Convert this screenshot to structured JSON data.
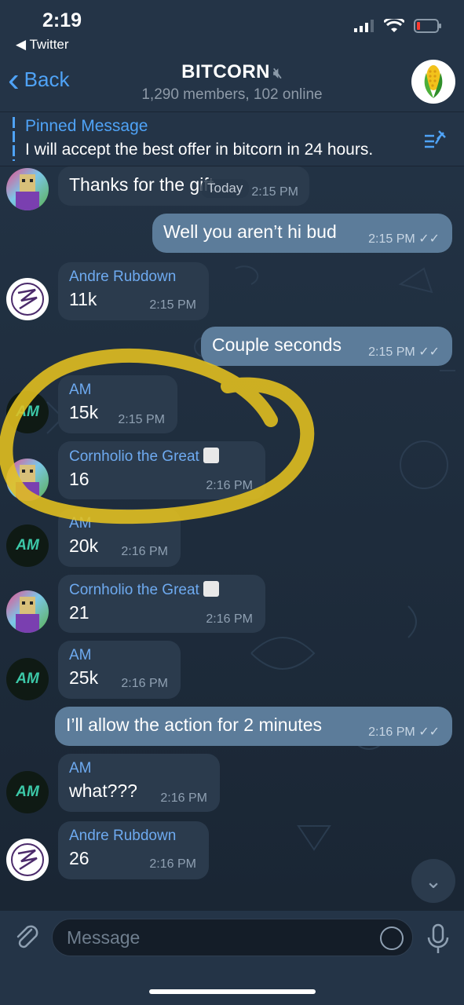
{
  "status": {
    "time": "2:19",
    "back_app": "◀ Twitter"
  },
  "header": {
    "back_label": "Back",
    "title": "BITCORN",
    "subtitle": "1,290 members, 102 online",
    "mute_icon": "speaker-muted-icon"
  },
  "pinned": {
    "title": "Pinned Message",
    "text": "I will accept the best offer in bitcorn in 24 hours."
  },
  "messages": [
    {
      "kind": "in",
      "sender": "",
      "text": "Thanks for the gift",
      "time": "2:15 PM",
      "overlay": "Today"
    },
    {
      "kind": "out",
      "text": "Well you aren’t hi bud",
      "time": "2:15 PM"
    },
    {
      "kind": "in",
      "sender": "Andre Rubdown",
      "text": "11k",
      "time": "2:15 PM"
    },
    {
      "kind": "out",
      "text": "Couple seconds",
      "time": "2:15 PM"
    },
    {
      "kind": "in",
      "sender": "AM",
      "text": "15k",
      "time": "2:15 PM"
    },
    {
      "kind": "in",
      "sender": "Cornholio the Great",
      "text": "16",
      "time": "2:16 PM"
    },
    {
      "kind": "in",
      "sender": "AM",
      "text": "20k",
      "time": "2:16 PM"
    },
    {
      "kind": "in",
      "sender": "Cornholio the Great",
      "text": "21",
      "time": "2:16 PM"
    },
    {
      "kind": "in",
      "sender": "AM",
      "text": "25k",
      "time": "2:16 PM"
    },
    {
      "kind": "out",
      "text": "I’ll allow the action for 2 minutes",
      "time": "2:16 PM"
    },
    {
      "kind": "in",
      "sender": "AM",
      "text": "what???",
      "time": "2:16 PM"
    },
    {
      "kind": "in",
      "sender": "Andre Rubdown",
      "text": "26",
      "time": "2:16 PM"
    }
  ],
  "avatars": {
    "am": "AM"
  },
  "input": {
    "placeholder": "Message"
  },
  "colors": {
    "accent": "#4fa3f7",
    "bubble_in": "#2b3b4d",
    "bubble_out": "#5c7c9a",
    "highlight": "#e5c11f"
  }
}
